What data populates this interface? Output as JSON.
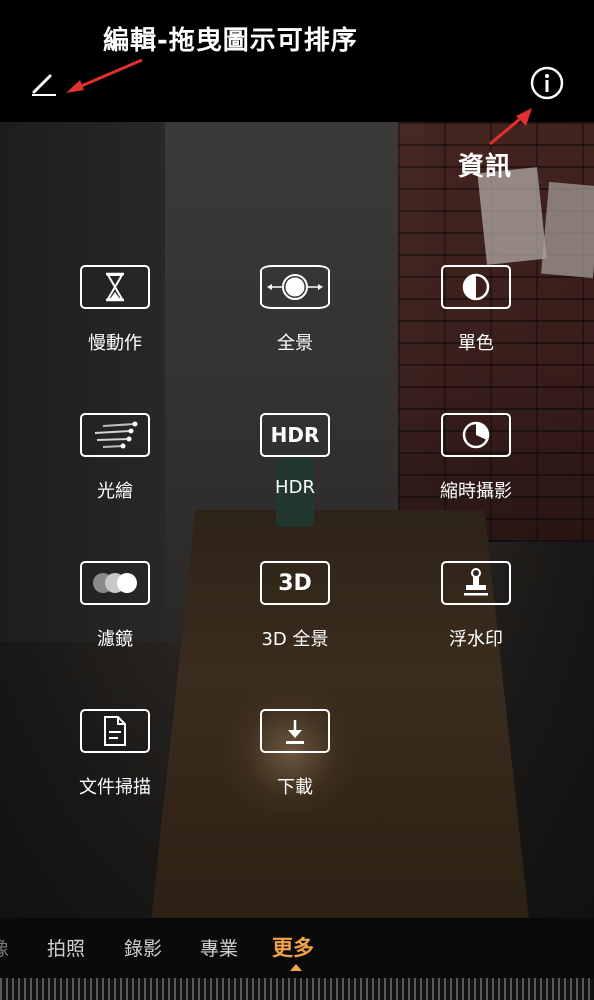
{
  "annotations": {
    "edit_note": "編輯-拖曳圖示可排序",
    "info_note": "資訊"
  },
  "modes": [
    {
      "label": "慢動作",
      "icon": "hourglass-icon"
    },
    {
      "label": "全景",
      "icon": "panorama-icon"
    },
    {
      "label": "單色",
      "icon": "monochrome-icon"
    },
    {
      "label": "光繪",
      "icon": "light-trail-icon"
    },
    {
      "label": "HDR",
      "icon": "hdr-icon",
      "icon_text": "HDR"
    },
    {
      "label": "縮時攝影",
      "icon": "timelapse-icon"
    },
    {
      "label": "濾鏡",
      "icon": "filter-icon"
    },
    {
      "label": "3D 全景",
      "icon": "3d-panorama-icon",
      "icon_text": "3D"
    },
    {
      "label": "浮水印",
      "icon": "watermark-stamp-icon"
    },
    {
      "label": "文件掃描",
      "icon": "document-scan-icon"
    },
    {
      "label": "下載",
      "icon": "download-icon"
    }
  ],
  "tabs": {
    "partial": "像",
    "photo": "拍照",
    "video": "錄影",
    "pro": "專業",
    "more": "更多"
  },
  "accent_color": "#f0a24a"
}
